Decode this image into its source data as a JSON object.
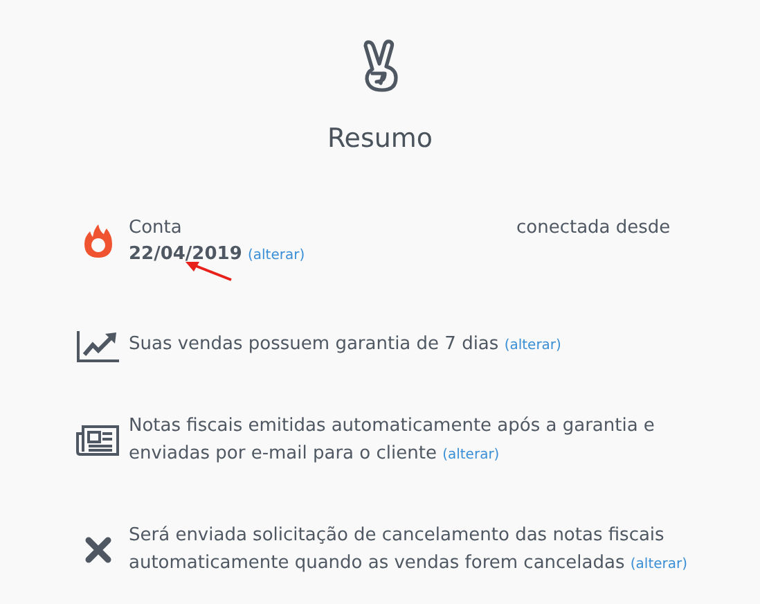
{
  "title": "Resumo",
  "items": [
    {
      "kind": "account",
      "label": "Conta",
      "status": "conectada desde",
      "date": "22/04/2019",
      "link": "(alterar)"
    },
    {
      "kind": "chart",
      "text": "Suas vendas possuem garantia de 7 dias",
      "link": "(alterar)"
    },
    {
      "kind": "invoice",
      "text": "Notas fiscais emitidas automaticamente após a garantia e enviadas por e-mail para o cliente",
      "link": "(alterar)"
    },
    {
      "kind": "cancel",
      "text": "Será enviada solicitação de cancelamento das notas fiscais automaticamente quando as vendas forem canceladas",
      "link": "(alterar)"
    }
  ]
}
